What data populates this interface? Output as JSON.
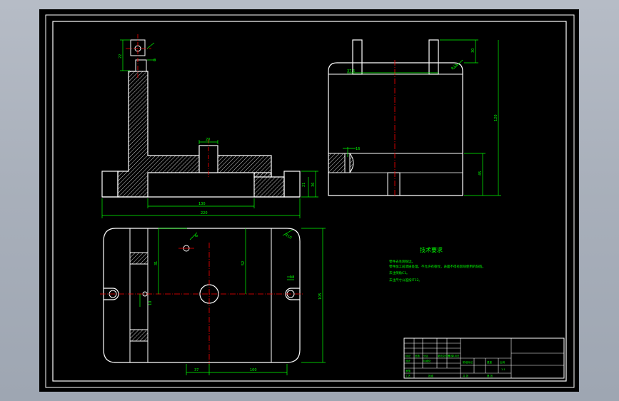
{
  "drawing": {
    "background": "#000000",
    "line_color": "#ffffff",
    "dimension_color": "#00ff00",
    "center_line_color": "#ff0000",
    "hatch_color": "#ffffff"
  },
  "front_view": {
    "dims": {
      "overall_width": "220",
      "inner_width": "130",
      "boss_width": "20",
      "right_h1": "21",
      "right_h2": "36",
      "top_a": "8",
      "top_b": "22"
    }
  },
  "side_view": {
    "dims": {
      "pin_offset": "37.5",
      "total_height": "120",
      "pin_height": "30",
      "base_height": "45",
      "corner_radius": "R15",
      "slot": "16"
    }
  },
  "top_view": {
    "dims": {
      "bottom_left": "37",
      "bottom_right": "100",
      "height": "105",
      "left_vertical": "31",
      "mid_vertical": "52",
      "corner_r": "R10",
      "slot_width": "12",
      "small_a": "8",
      "small_b": "10"
    }
  },
  "notes": {
    "title": "技术要求",
    "lines": [
      "零件去毛刺锐边。",
      "零件加工前调质处理，不允许有裂纹，表面不得有影响使用的缺陷。",
      "未注倒角C1。",
      "未注尺寸公差按IT12。"
    ]
  },
  "title_block": {
    "labels": [
      "标记",
      "处数",
      "分区",
      "更改文件号",
      "签名",
      "年月日",
      "设计",
      "标准化",
      "阶段标记",
      "重量",
      "比例",
      "审核",
      "工艺",
      "批准",
      "共 张",
      "第 张"
    ],
    "scale": "1:1"
  }
}
